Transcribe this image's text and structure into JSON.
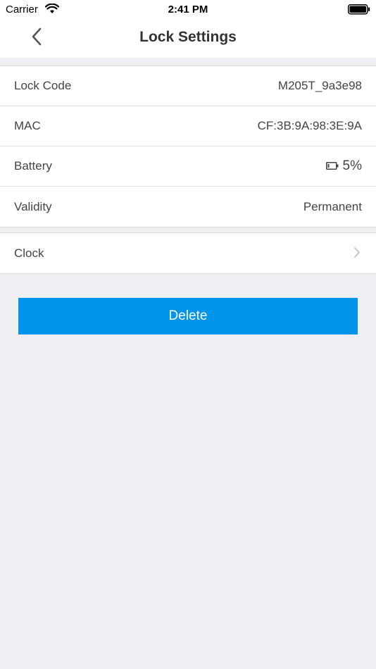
{
  "status_bar": {
    "carrier": "Carrier",
    "time": "2:41 PM",
    "icons": [
      "wifi-icon",
      "battery-full-icon"
    ]
  },
  "nav": {
    "title": "Lock Settings",
    "back_icon": "chevron-left-icon"
  },
  "info": {
    "lock_code_label": "Lock Code",
    "lock_code_value": "M205T_9a3e98",
    "mac_label": "MAC",
    "mac_value": "CF:3B:9A:98:3E:9A",
    "battery_label": "Battery",
    "battery_value": "5%",
    "battery_icon": "battery-low-icon",
    "validity_label": "Validity",
    "validity_value": "Permanent"
  },
  "clock": {
    "label": "Clock",
    "chevron_icon": "chevron-right-icon"
  },
  "actions": {
    "delete_label": "Delete"
  },
  "colors": {
    "accent": "#0095ea",
    "background": "#efeff4",
    "surface": "#ffffff"
  }
}
